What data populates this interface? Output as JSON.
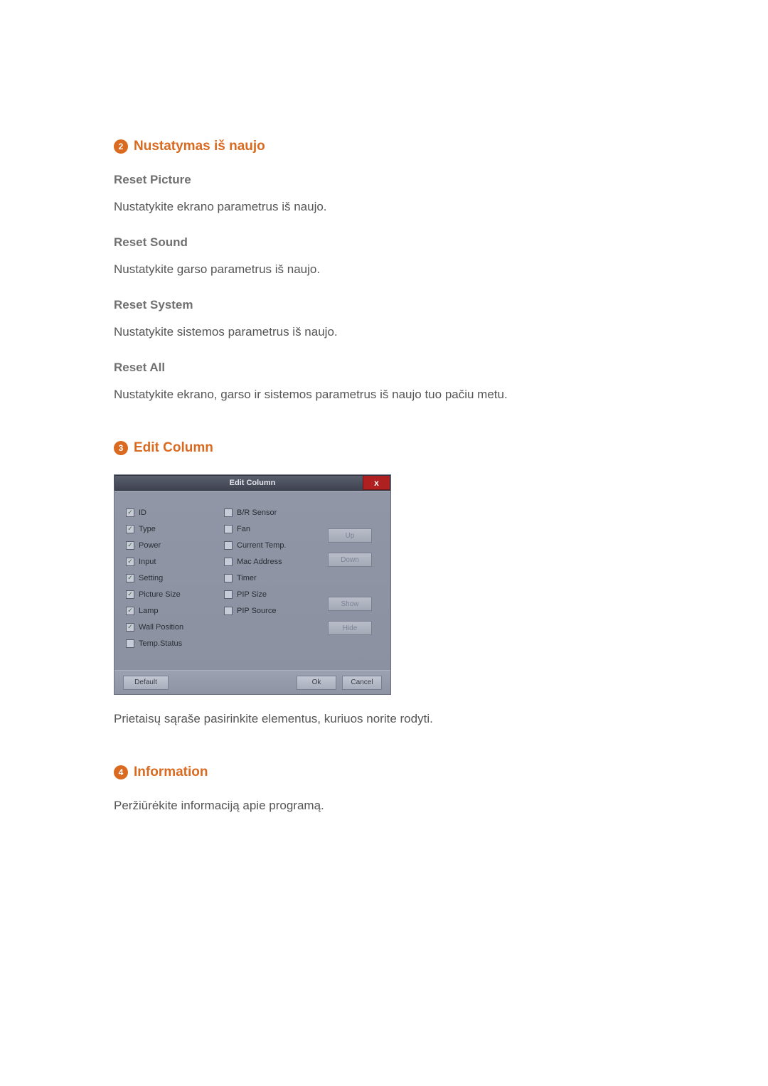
{
  "section2": {
    "num": "2",
    "title": "Nustatymas iš naujo",
    "items": [
      {
        "heading": "Reset Picture",
        "text": "Nustatykite ekrano parametrus iš naujo."
      },
      {
        "heading": "Reset Sound",
        "text": "Nustatykite garso parametrus iš naujo."
      },
      {
        "heading": "Reset System",
        "text": "Nustatykite sistemos parametrus iš naujo."
      },
      {
        "heading": "Reset All",
        "text": "Nustatykite ekrano, garso ir sistemos parametrus iš naujo tuo pačiu metu."
      }
    ]
  },
  "section3": {
    "num": "3",
    "title": "Edit Column",
    "dialog": {
      "title": "Edit Column",
      "close": "x",
      "left": [
        {
          "label": "ID",
          "checked": true
        },
        {
          "label": "Type",
          "checked": true
        },
        {
          "label": "Power",
          "checked": true
        },
        {
          "label": "Input",
          "checked": true
        },
        {
          "label": "Setting",
          "checked": true
        },
        {
          "label": "Picture Size",
          "checked": true
        },
        {
          "label": "Lamp",
          "checked": true
        },
        {
          "label": "Wall Position",
          "checked": true
        },
        {
          "label": "Temp.Status",
          "checked": false
        }
      ],
      "mid": [
        {
          "label": "B/R Sensor",
          "checked": false
        },
        {
          "label": "Fan",
          "checked": false
        },
        {
          "label": "Current Temp.",
          "checked": false
        },
        {
          "label": "Mac Address",
          "checked": false
        },
        {
          "label": "Timer",
          "checked": false
        },
        {
          "label": "PIP Size",
          "checked": false
        },
        {
          "label": "PIP Source",
          "checked": false
        }
      ],
      "side_buttons": {
        "up": "Up",
        "down": "Down",
        "show": "Show",
        "hide": "Hide"
      },
      "footer": {
        "default": "Default",
        "ok": "Ok",
        "cancel": "Cancel"
      }
    },
    "caption": "Prietaisų sąraše pasirinkite elementus, kuriuos norite rodyti."
  },
  "section4": {
    "num": "4",
    "title": "Information",
    "text": "Peržiūrėkite informaciją apie programą."
  }
}
